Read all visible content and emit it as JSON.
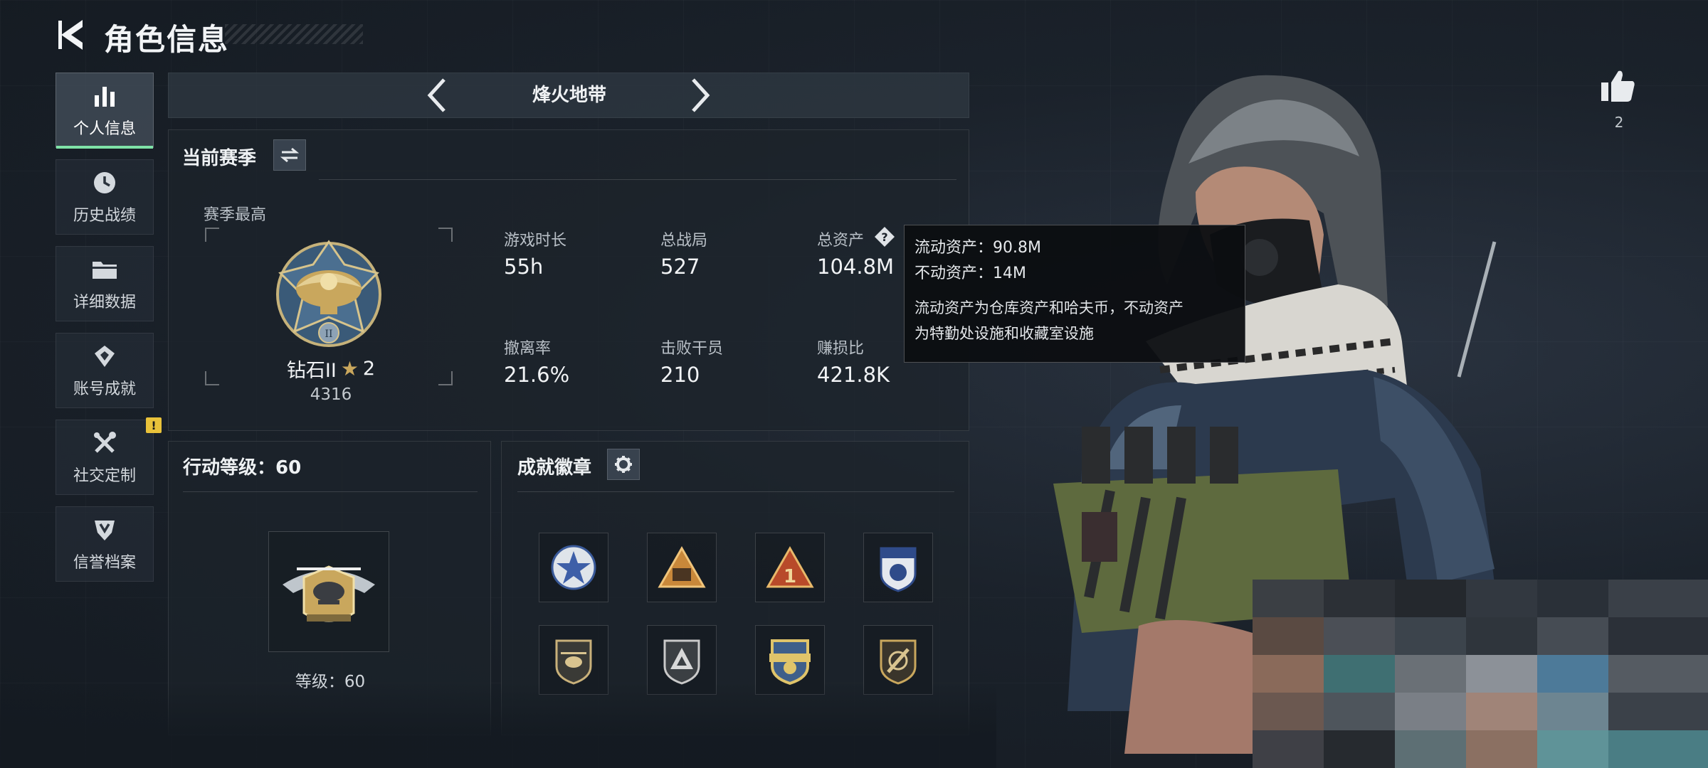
{
  "header": {
    "title": "角色信息"
  },
  "sidebar": {
    "items": [
      {
        "label": "个人信息",
        "icon": "bar-chart-icon",
        "active": true
      },
      {
        "label": "历史战绩",
        "icon": "clock-icon"
      },
      {
        "label": "详细数据",
        "icon": "folder-icon"
      },
      {
        "label": "账号成就",
        "icon": "medal-icon"
      },
      {
        "label": "社交定制",
        "icon": "tools-icon",
        "badge": "!"
      },
      {
        "label": "信誉档案",
        "icon": "shield-icon"
      }
    ]
  },
  "mode": {
    "name": "烽火地带"
  },
  "season": {
    "title": "当前赛季",
    "best_label": "赛季最高",
    "rank_name": "钻石II",
    "rank_stars": "2",
    "rank_points": "4316",
    "stats": [
      {
        "label": "游戏时长",
        "value": "55h"
      },
      {
        "label": "总战局",
        "value": "527"
      },
      {
        "label": "总资产",
        "value": "104.8M",
        "has_help": true
      },
      {
        "label": "撤离率",
        "value": "21.6%"
      },
      {
        "label": "击败干员",
        "value": "210"
      },
      {
        "label": "赚损比",
        "value": "421.8K"
      }
    ]
  },
  "tooltip": {
    "liquid": "流动资产：90.8M",
    "fixed": "不动资产：14M",
    "desc_line1": "流动资产为仓库资产和哈夫币，不动资产",
    "desc_line2": "为特勤处设施和收藏室设施"
  },
  "level": {
    "title": "行动等级：60",
    "caption": "等级：60"
  },
  "badges": {
    "title": "成就徽章",
    "items": [
      "star-badge-icon",
      "squad-badge-icon",
      "number-one-badge-icon",
      "police-badge-icon",
      "helicopter-badge-icon",
      "triangle-badge-icon",
      "shield-emblem-icon",
      "knife-badge-icon"
    ]
  },
  "like": {
    "count": "2"
  },
  "colors": {
    "accent": "#7fe3a8",
    "warning": "#e9c23a"
  }
}
